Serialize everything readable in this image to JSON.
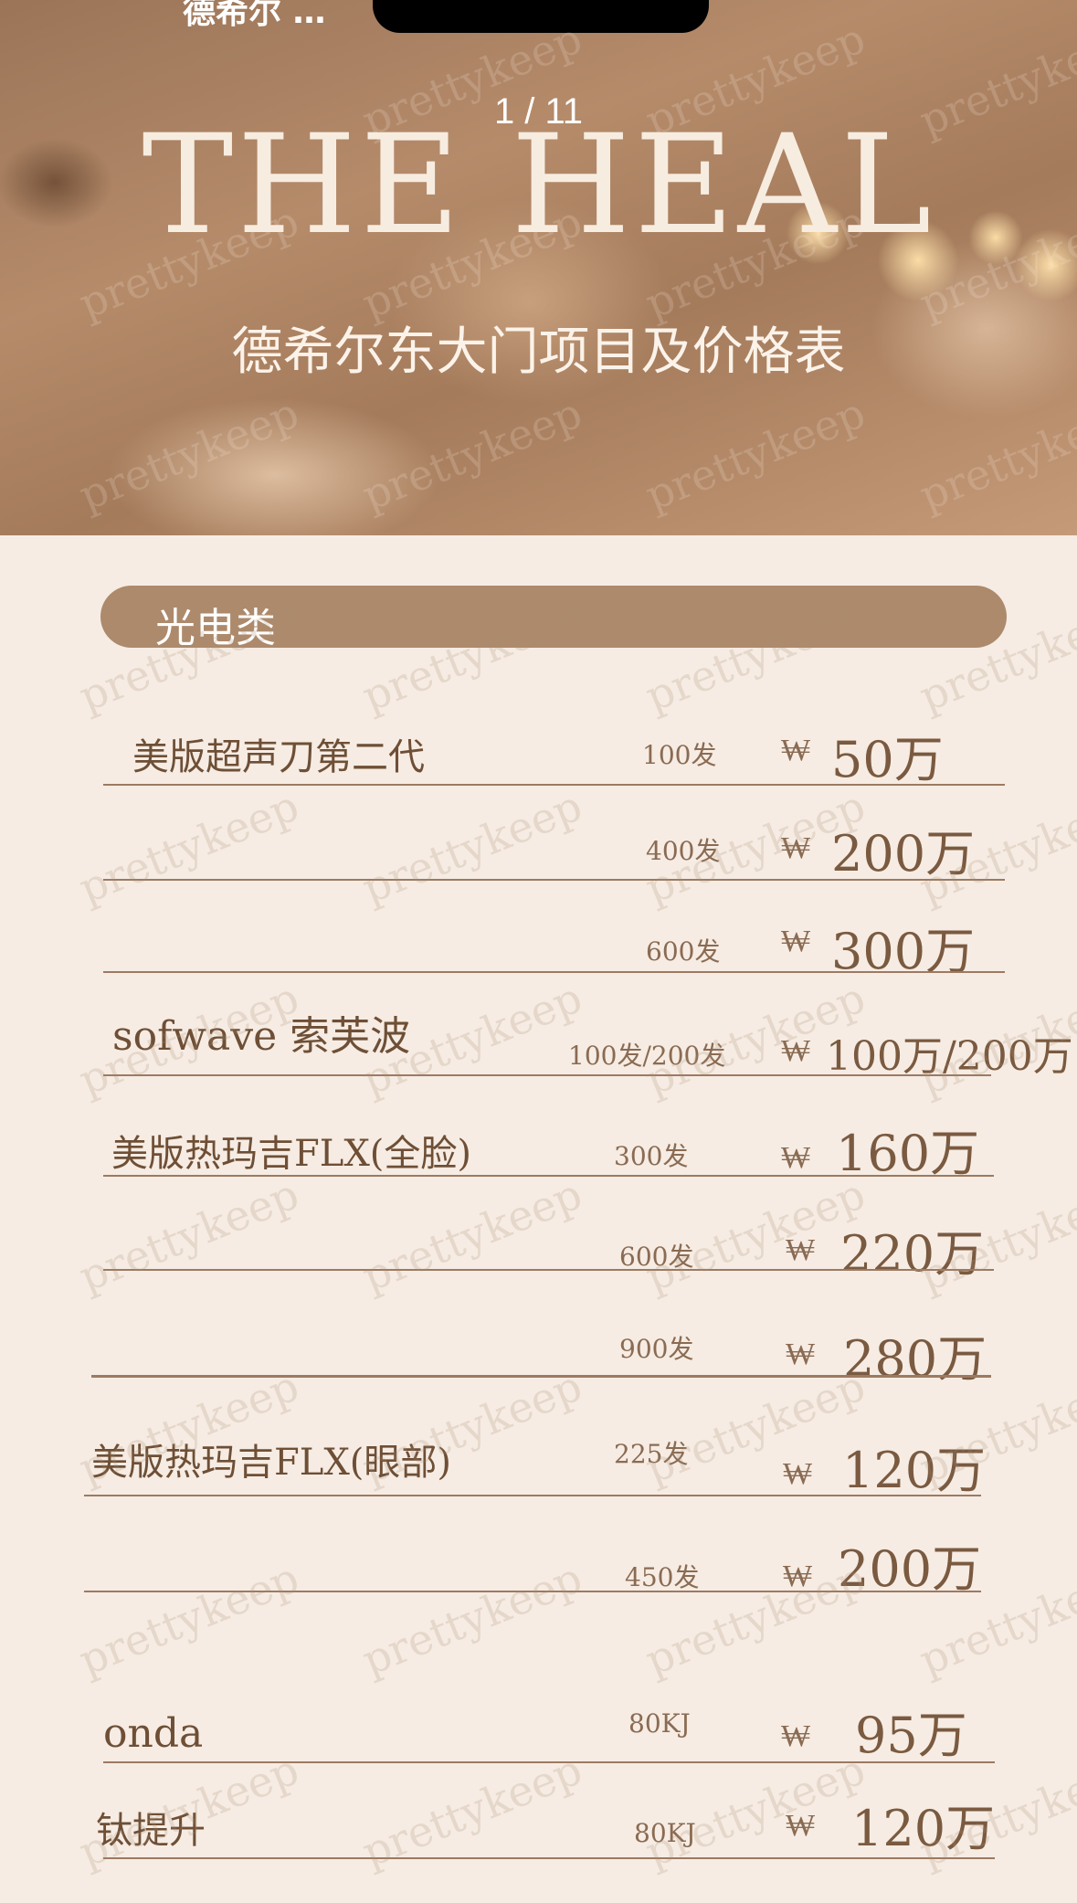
{
  "hero": {
    "cut_text": "德希尔 …",
    "page_indicator": "1 / 11",
    "title": "THE HEAL",
    "subtitle": "德希尔东大门项目及价格表"
  },
  "section": {
    "title": "光电类"
  },
  "currency_symbol": "₩",
  "items": [
    {
      "name": "美版超声刀第二代",
      "qty": "100发",
      "price": "50万"
    },
    {
      "name": "",
      "qty": "400发",
      "price": "200万"
    },
    {
      "name": "",
      "qty": "600发",
      "price": "300万"
    },
    {
      "name": "sofwave 索芙波",
      "qty": "100发/200发",
      "price": "100万/200万"
    },
    {
      "name": "美版热玛吉FLX(全脸)",
      "qty": "300发",
      "price": "160万"
    },
    {
      "name": "",
      "qty": "600发",
      "price": "220万"
    },
    {
      "name": "",
      "qty": "900发",
      "price": "280万"
    },
    {
      "name": "美版热玛吉FLX(眼部)",
      "qty": "225发",
      "price": "120万"
    },
    {
      "name": "",
      "qty": "450发",
      "price": "200万"
    },
    {
      "name": "onda",
      "qty": "80KJ",
      "price": "95万"
    },
    {
      "name": "钛提升",
      "qty": "80KJ",
      "price": "120万"
    }
  ],
  "watermark": "prettykeep",
  "colors": {
    "background": "#f6ece3",
    "pill": "#ad8a6c",
    "text": "#7a5a40",
    "line": "#9c7a62"
  }
}
